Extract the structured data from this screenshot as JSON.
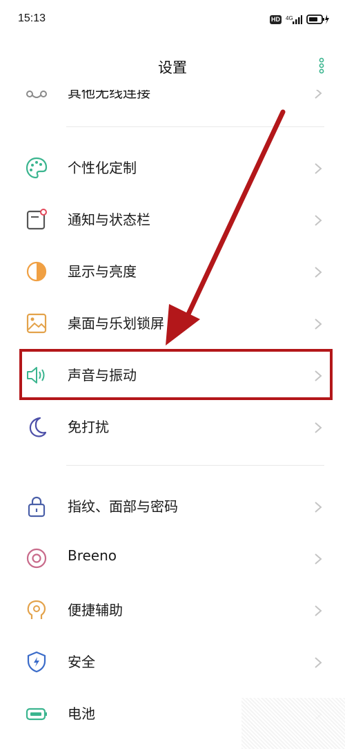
{
  "status_bar": {
    "time": "15:13",
    "hd": "HD",
    "network": "4G"
  },
  "header": {
    "title": "设置"
  },
  "settings_items": [
    {
      "key": "other-wireless",
      "label": "其他无线连接",
      "icon": "link-icon",
      "color": "#8a8a8a"
    },
    {
      "key": "personalization",
      "label": "个性化定制",
      "icon": "palette-icon",
      "color": "#3bb58f"
    },
    {
      "key": "notifications",
      "label": "通知与状态栏",
      "icon": "notification-icon",
      "color": "#555555"
    },
    {
      "key": "display",
      "label": "显示与亮度",
      "icon": "brightness-icon",
      "color": "#f0a043"
    },
    {
      "key": "wallpaper",
      "label": "桌面与乐划锁屏",
      "icon": "wallpaper-icon",
      "color": "#e3a24a"
    },
    {
      "key": "sound",
      "label": "声音与振动",
      "icon": "speaker-icon",
      "color": "#3bb58f"
    },
    {
      "key": "dnd",
      "label": "免打扰",
      "icon": "moon-icon",
      "color": "#4c4fa8"
    },
    {
      "key": "security-pw",
      "label": "指纹、面部与密码",
      "icon": "lock-icon",
      "color": "#4a5fa8"
    },
    {
      "key": "breeno",
      "label": "Breeno",
      "icon": "breeno-icon",
      "color": "#c86a8a"
    },
    {
      "key": "accessibility",
      "label": "便捷辅助",
      "icon": "head-icon",
      "color": "#e3a24a"
    },
    {
      "key": "security",
      "label": "安全",
      "icon": "shield-icon",
      "color": "#3a6bc9"
    },
    {
      "key": "battery",
      "label": "电池",
      "icon": "battery-icon",
      "color": "#3bb58f"
    }
  ],
  "annotation": {
    "highlight_color": "#b3171a"
  }
}
